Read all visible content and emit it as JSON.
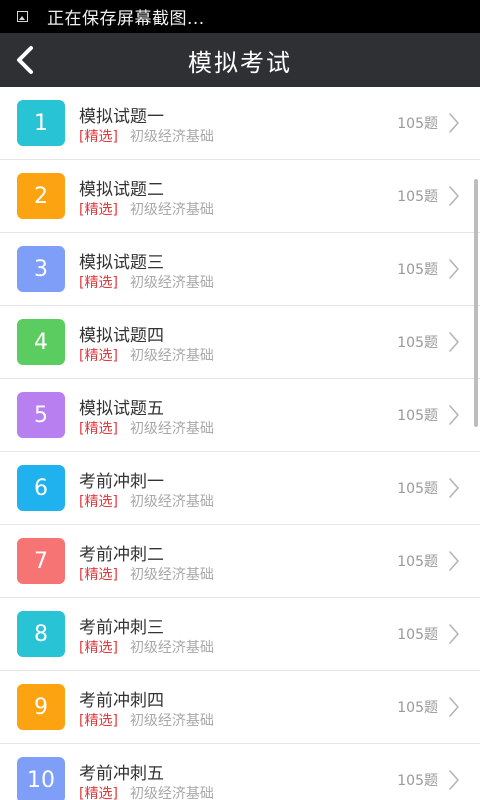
{
  "status_bar": {
    "notification_text": "正在保存屏幕截图..."
  },
  "header": {
    "title": "模拟考试"
  },
  "list": {
    "items": [
      {
        "number": "1",
        "title": "模拟试题一",
        "tag": "[精选]",
        "subject": "初级经济基础",
        "count": "105题",
        "color": "#29c3d6"
      },
      {
        "number": "2",
        "title": "模拟试题二",
        "tag": "[精选]",
        "subject": "初级经济基础",
        "count": "105题",
        "color": "#fca311"
      },
      {
        "number": "3",
        "title": "模拟试题三",
        "tag": "[精选]",
        "subject": "初级经济基础",
        "count": "105题",
        "color": "#7f9ef8"
      },
      {
        "number": "4",
        "title": "模拟试题四",
        "tag": "[精选]",
        "subject": "初级经济基础",
        "count": "105题",
        "color": "#5bcc5f"
      },
      {
        "number": "5",
        "title": "模拟试题五",
        "tag": "[精选]",
        "subject": "初级经济基础",
        "count": "105题",
        "color": "#b77ff0"
      },
      {
        "number": "6",
        "title": "考前冲刺一",
        "tag": "[精选]",
        "subject": "初级经济基础",
        "count": "105题",
        "color": "#1fb2ee"
      },
      {
        "number": "7",
        "title": "考前冲刺二",
        "tag": "[精选]",
        "subject": "初级经济基础",
        "count": "105题",
        "color": "#f67473"
      },
      {
        "number": "8",
        "title": "考前冲刺三",
        "tag": "[精选]",
        "subject": "初级经济基础",
        "count": "105题",
        "color": "#29c3d6"
      },
      {
        "number": "9",
        "title": "考前冲刺四",
        "tag": "[精选]",
        "subject": "初级经济基础",
        "count": "105题",
        "color": "#fca311"
      },
      {
        "number": "10",
        "title": "考前冲刺五",
        "tag": "[精选]",
        "subject": "初级经济基础",
        "count": "105题",
        "color": "#7f9ef8"
      }
    ]
  },
  "colors": {
    "status_bar_bg": "#000000",
    "header_bg": "#2e3033",
    "tag_red": "#e0393e",
    "subject_gray": "#a9a9a9"
  },
  "icons": {
    "status_notification": "image-icon",
    "back": "chevron-left-icon",
    "row_arrow": "chevron-right-icon"
  }
}
